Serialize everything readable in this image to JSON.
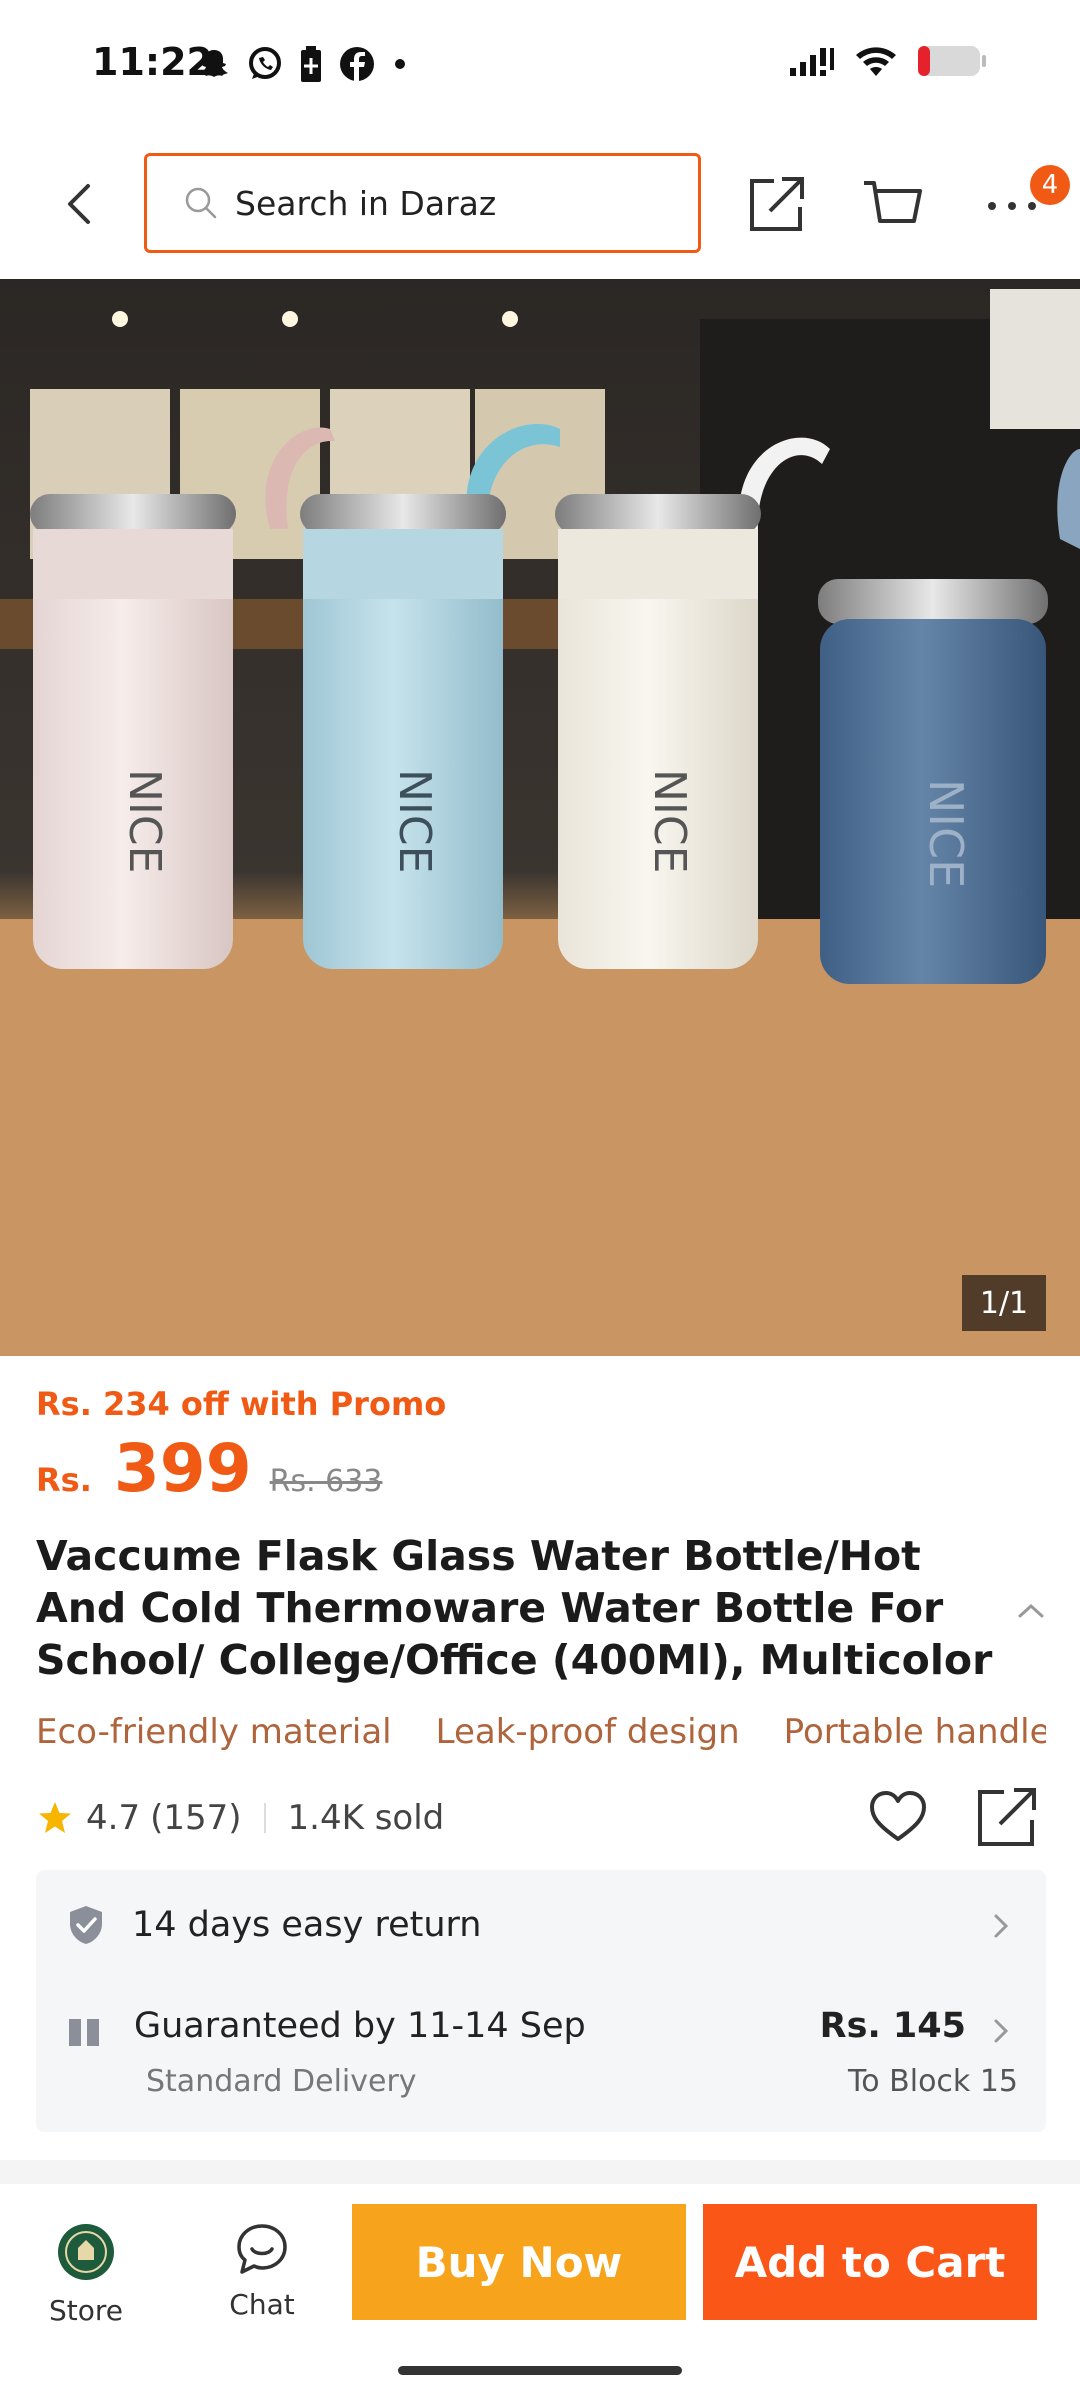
{
  "status_bar": {
    "time": "11:22",
    "icons": [
      "snapchat-icon",
      "whatsapp-icon",
      "battery-saver-icon",
      "facebook-icon",
      "dot-icon"
    ],
    "right_icons": [
      "signal-icon",
      "wifi-icon",
      "battery-icon"
    ]
  },
  "header": {
    "search_placeholder": "Search in Daraz",
    "cart_badge": "4"
  },
  "gallery": {
    "counter": "1/1"
  },
  "price": {
    "promo": "Rs. 234 off with Promo",
    "currency": "Rs.",
    "current": "399",
    "original": "Rs. 633"
  },
  "product": {
    "title": "Vaccume Flask Glass Water Bottle/Hot And Cold Thermoware Water Bottle For School/ College/Office (400Ml), Multicolor",
    "features": [
      "Eco-friendly material",
      "Leak-proof design",
      "Portable handle"
    ],
    "rating": "4.7",
    "reviews": "(157)",
    "sold": "1.4K sold"
  },
  "services": {
    "return_label": "14 days easy return",
    "delivery_label": "Guaranteed by 11-14 Sep",
    "delivery_type": "Standard Delivery",
    "delivery_fee": "Rs. 145",
    "delivery_location": "To Block 15"
  },
  "bottom": {
    "store_label": "Store",
    "chat_label": "Chat",
    "buy_now": "Buy Now",
    "add_to_cart": "Add to Cart"
  },
  "colors": {
    "accent": "#f05a14",
    "buy_now": "#f7a31c",
    "add_to_cart": "#f95617",
    "feature_text": "#b0643c"
  }
}
